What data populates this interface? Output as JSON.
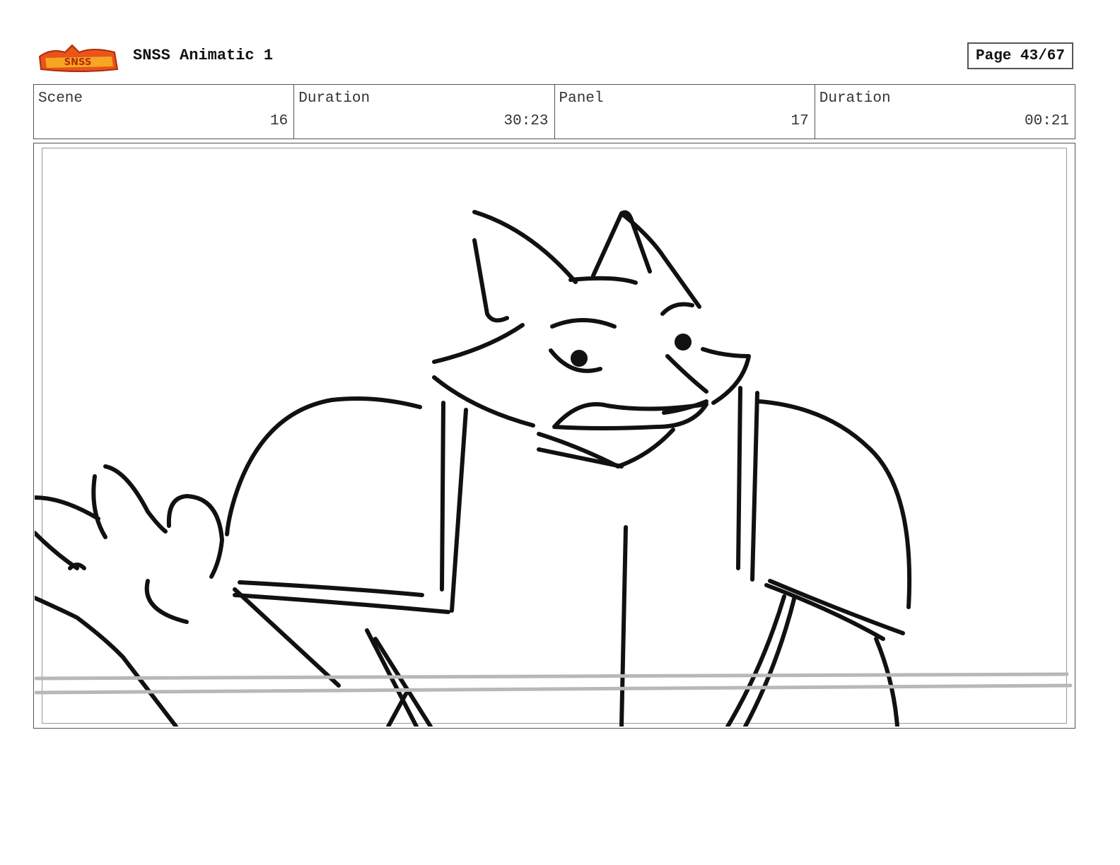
{
  "header": {
    "logo_icon": "show-logo-icon",
    "title": "SNSS Animatic 1",
    "page": "Page 43/67"
  },
  "info": {
    "scene_label": "Scene",
    "scene_value": "16",
    "scene_duration_label": "Duration",
    "scene_duration_value": "30:23",
    "panel_label": "Panel",
    "panel_value": "17",
    "panel_duration_label": "Duration",
    "panel_duration_value": "00:21"
  },
  "panel": {
    "drawing_icon": "storyboard-sketch-icon"
  }
}
